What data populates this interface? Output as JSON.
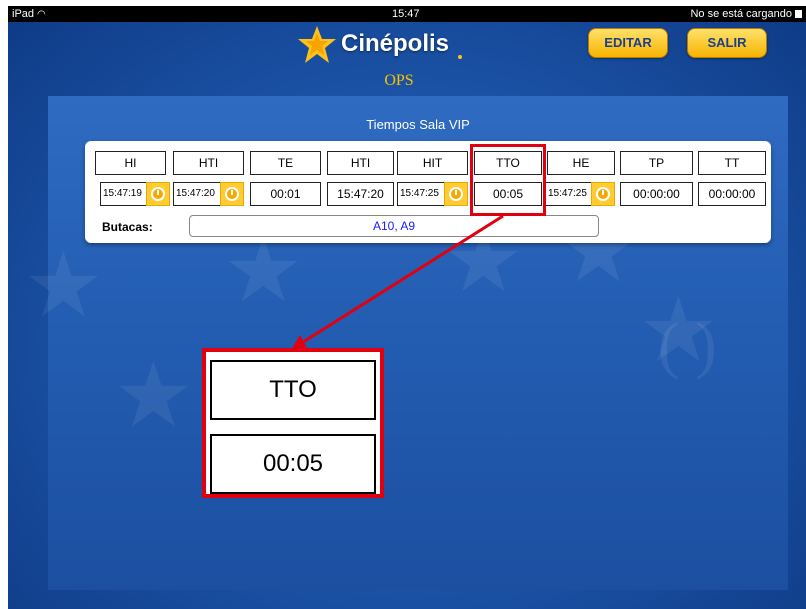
{
  "status_bar": {
    "device": "iPad",
    "time": "15:47",
    "charging": "No se está cargando"
  },
  "header": {
    "brand": "Cinépolis",
    "subtitle": "OPS",
    "edit_label": "EDITAR",
    "exit_label": "SALIR"
  },
  "section": {
    "title": "Tiempos Sala VIP"
  },
  "table": {
    "headers": [
      "HI",
      "HTI",
      "TE",
      "HTI",
      "HIT",
      "TTO",
      "HE",
      "TP",
      "TT"
    ],
    "values": [
      "15:47:19",
      "15:47:20",
      "00:01",
      "15:47:20",
      "15:47:25",
      "00:05",
      "15:47:25",
      "00:00:00",
      "00:00:00"
    ]
  },
  "butacas": {
    "label": "Butacas:",
    "value": "A10, A9"
  },
  "callout": {
    "header": "TTO",
    "value": "00:05"
  },
  "colors": {
    "accent_yellow": "#f5c300",
    "highlight_red": "#e00010",
    "background_blue": "#1d56aa"
  }
}
